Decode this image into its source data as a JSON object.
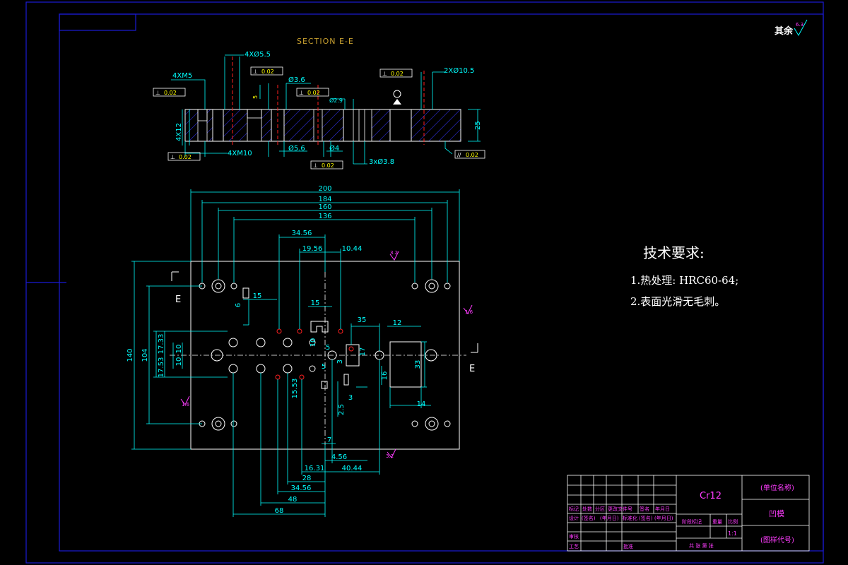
{
  "colors": {
    "frame": "#1a1ad6",
    "object": "#ffffff",
    "dimension": "#00ffff",
    "hatch": "#3030e0",
    "text_yellow": "#ffff00",
    "text_magenta": "#ff3cff",
    "section_title": "#c8a030",
    "center_red": "#ff2020",
    "green": "#00ff00"
  },
  "corner_roughness": {
    "label": "其余",
    "value": "6.3"
  },
  "section": {
    "title": "SECTION E-E",
    "callouts": {
      "holes_4x5": "4XØ5.5",
      "thread_4xm5": "4XM5",
      "hole_36": "Ø3.6",
      "hole_29": "Ø2.9",
      "holes_2x10": "2XØ10.5",
      "dim_56": "Ø5.6",
      "dim_4": "Ø4",
      "thread_4xm10": "4XM10",
      "holes_3x38": "3xØ3.8",
      "depth_4x12": "4X12",
      "thickness": "25",
      "dim_5": "5",
      "flatness_1": "0.02",
      "flatness_2": "0.02",
      "flatness_3": "0.02",
      "flatness_4": "0.02",
      "flatness_5": "0.02",
      "parallel": "0.02"
    }
  },
  "plan": {
    "width_dims": {
      "d200": "200",
      "d184": "184",
      "d160": "160",
      "d136": "136"
    },
    "top_dims": {
      "d3456": "34.56",
      "d1956": "19.56",
      "d1044": "10.44"
    },
    "left_dims": {
      "d140": "140",
      "d104": "104",
      "d1753": "17.53",
      "d1733": "17.33",
      "d10a": "10",
      "d10b": "10"
    },
    "bottom_dims": {
      "d7": "7",
      "d456": "4.56",
      "d1631": "16.31",
      "d4044": "40.44",
      "d28": "28",
      "d3456b": "34.56",
      "d48": "48",
      "d68": "68"
    },
    "inner_dims": {
      "d15a": "15",
      "d15b": "15",
      "d35": "35",
      "d12": "12",
      "d33": "33",
      "d14": "14",
      "d10": "10",
      "d5a": "5",
      "d5b": "5",
      "d17": "17",
      "d16": "16",
      "d2553": "15.53",
      "d255": "2.5",
      "d34": "3",
      "d3x": "3",
      "d6": "6"
    },
    "section_mark": "E",
    "roughness": {
      "r16a": "1.6",
      "r16b": "1.6",
      "r32a": "3.2",
      "r32b": "3.2"
    }
  },
  "tech_req": {
    "heading": "技术要求:",
    "item1": "1.热处理: HRC60-64;",
    "item2": "2.表面光滑无毛刺。"
  },
  "title_block": {
    "material": "Cr12",
    "unit_name": "(单位名称)",
    "part_name": "凹模",
    "drawing_no": "(图样代号)",
    "scale": "1:1",
    "row_labels": [
      "标记",
      "处数",
      "分区",
      "更改文件号",
      "签名",
      "年月日"
    ],
    "design_row": [
      "设计",
      "(签名)",
      "(年月日)",
      "标准化",
      "(签名)",
      "(年月日)"
    ],
    "stage_label": "阶段标记",
    "weight_label": "重量",
    "scale_label": "比例",
    "review_label": "审核",
    "process_label": "工艺",
    "approve_label": "批准",
    "sheets_label": "共   张   第   张"
  }
}
